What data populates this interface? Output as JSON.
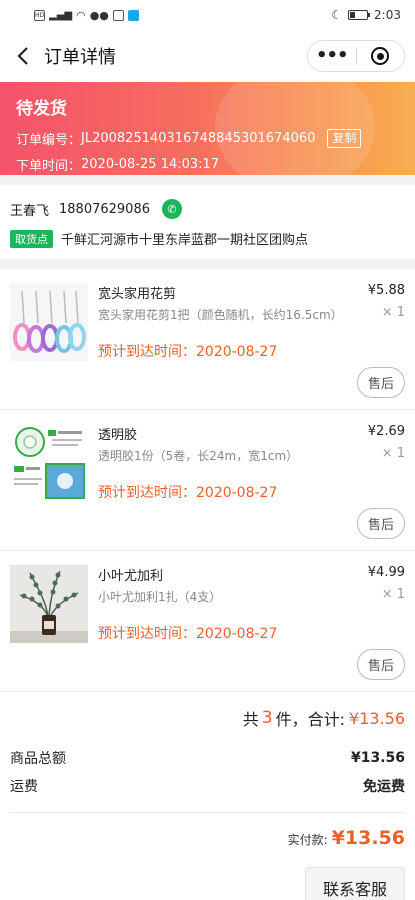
{
  "status_bar": {
    "left_icons": [
      "HD",
      "4G",
      "signal",
      "wifi",
      "wechat",
      "app",
      "app-blue"
    ],
    "time": "2:03"
  },
  "nav": {
    "title": "订单详情",
    "more_label": "•••"
  },
  "banner": {
    "status": "待发货",
    "order_no_label": "订单编号：",
    "order_no": "JL20082514031674884530167406​0",
    "copy_label": "复制",
    "order_time_label": "下单时间：",
    "order_time": "2020-08-25 14:03:17",
    "colors": {
      "start": "#f5536b",
      "end": "#f8ae50"
    }
  },
  "address": {
    "name": "王春飞",
    "phone": "18807629086",
    "pickup_badge": "取货点",
    "pickup_address": "千鲜汇河源市十里东岸蓝郡一期社区团购点"
  },
  "items": [
    {
      "name": "宽头家用花剪",
      "spec": "宽头家用花剪1把（颜色随机，长约16.5cm）",
      "price": "¥5.88",
      "qty": "× 1",
      "eta": "预计到达时间：2020-08-27",
      "after_sale_label": "售后",
      "thumb_icon": "scissors-product"
    },
    {
      "name": "透明胶",
      "spec": "透明胶1份（5卷，长24m，宽1cm）",
      "price": "¥2.69",
      "qty": "× 1",
      "eta": "预计到达时间：2020-08-27",
      "after_sale_label": "售后",
      "thumb_icon": "tape-product"
    },
    {
      "name": "小叶尤加利",
      "spec": "小叶尤加利1扎（4支）",
      "price": "¥4.99",
      "qty": "× 1",
      "eta": "预计到达时间：2020-08-27",
      "after_sale_label": "售后",
      "thumb_icon": "eucalyptus-product"
    }
  ],
  "summary": {
    "count_prefix": "共",
    "count": "3",
    "count_suffix": "件，合计:",
    "total": "¥13.56",
    "goods_total_label": "商品总额",
    "goods_total": "¥13.56",
    "shipping_label": "运费",
    "shipping": "免运费",
    "paid_label": "实付款:",
    "paid": "¥13.56",
    "service_label": "联系客服"
  },
  "colors": {
    "accent": "#e8622c",
    "green": "#1bb55c"
  }
}
